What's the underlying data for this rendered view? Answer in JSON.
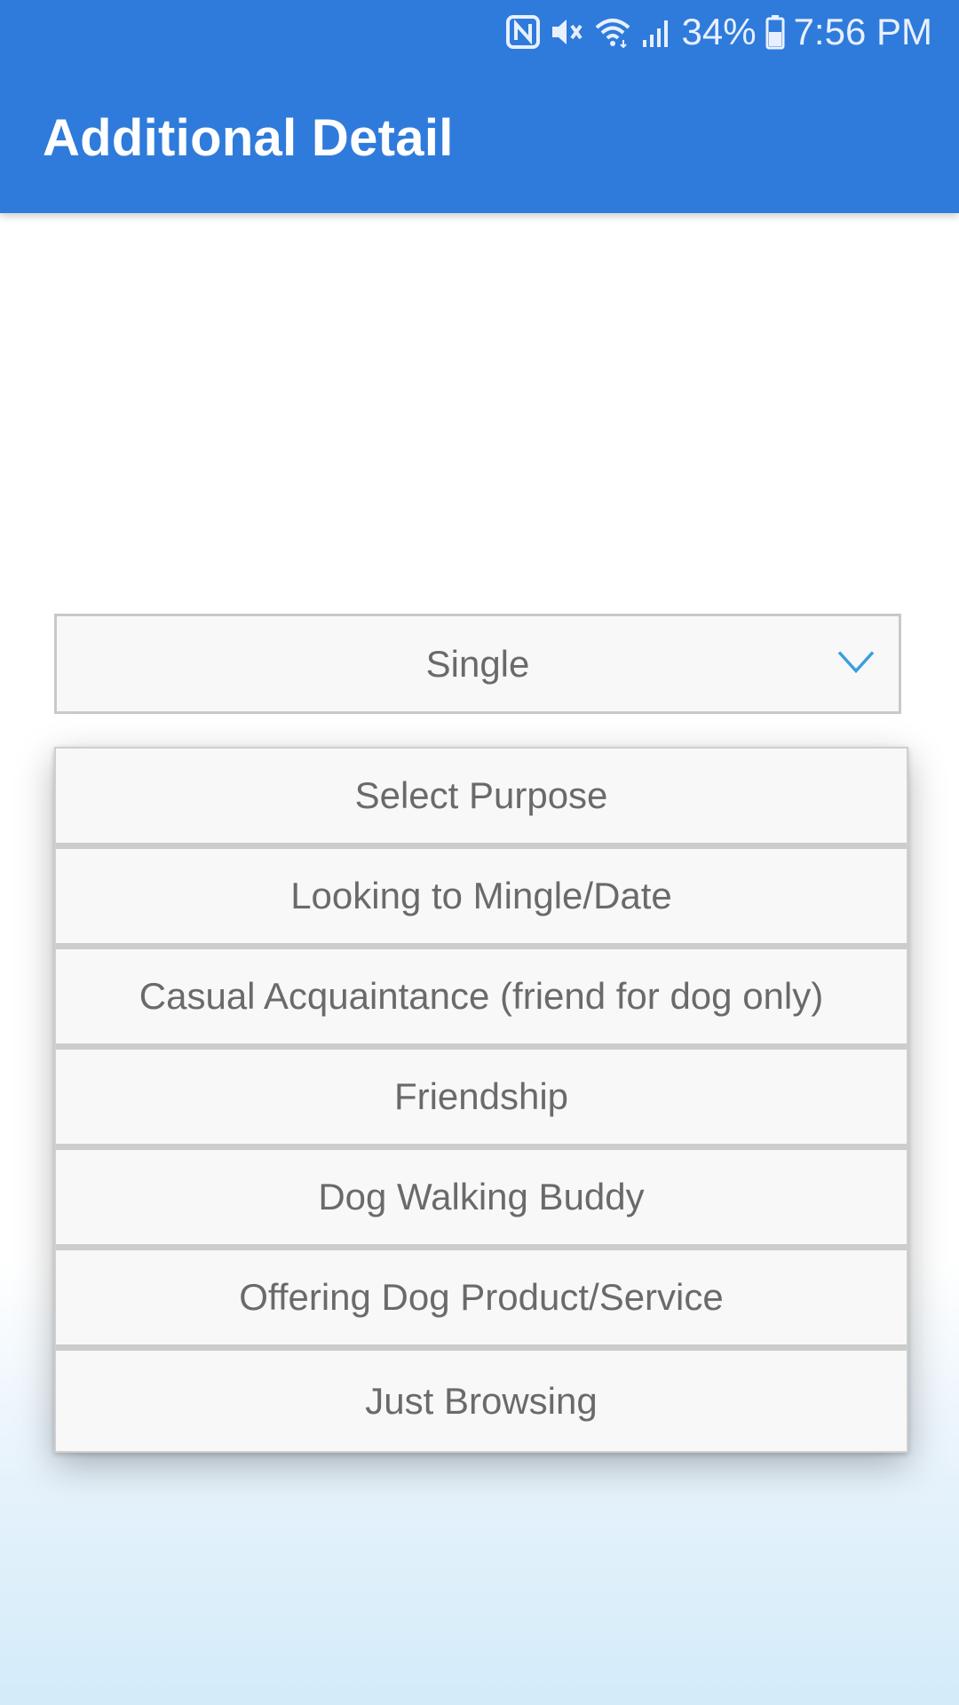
{
  "status_bar": {
    "battery_percent": "34%",
    "time": "7:56 PM",
    "icons": [
      "nfc-icon",
      "mute-icon",
      "wifi-icon",
      "signal-icon",
      "battery-icon"
    ]
  },
  "app_bar": {
    "title": "Additional Detail",
    "color": "#2f7bdb"
  },
  "relationship_select": {
    "value": "Single",
    "chevron_color": "#3aa0e0"
  },
  "purpose_dropdown": {
    "options": [
      "Select Purpose",
      "Looking to Mingle/Date",
      "Casual Acquaintance (friend for dog only)",
      "Friendship",
      "Dog Walking Buddy",
      "Offering Dog Product/Service",
      "Just Browsing"
    ]
  }
}
